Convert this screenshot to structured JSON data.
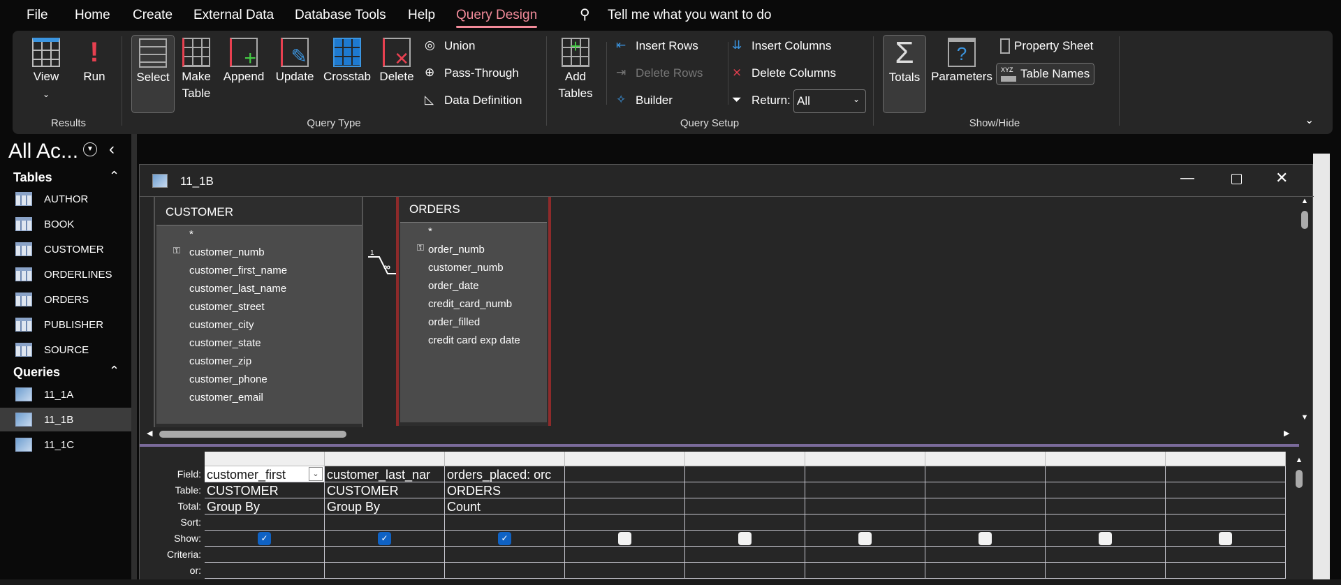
{
  "menu": {
    "items": [
      "File",
      "Home",
      "Create",
      "External Data",
      "Database Tools",
      "Help",
      "Query Design"
    ],
    "search": "Tell me what you want to do"
  },
  "ribbon": {
    "results": {
      "label": "Results",
      "view": "View",
      "run": "Run"
    },
    "query_type": {
      "label": "Query Type",
      "select": "Select",
      "make_table_1": "Make",
      "make_table_2": "Table",
      "append": "Append",
      "update": "Update",
      "crosstab": "Crosstab",
      "delete": "Delete",
      "union": "Union",
      "pass_through": "Pass-Through",
      "data_definition": "Data Definition"
    },
    "query_setup": {
      "label": "Query Setup",
      "add_tables_1": "Add",
      "add_tables_2": "Tables",
      "insert_rows": "Insert Rows",
      "delete_rows": "Delete Rows",
      "builder": "Builder",
      "insert_columns": "Insert Columns",
      "delete_columns": "Delete Columns",
      "return_label": "Return:",
      "return_value": "All"
    },
    "show_hide": {
      "label": "Show/Hide",
      "totals": "Totals",
      "parameters": "Parameters",
      "property_sheet": "Property Sheet",
      "table_names": "Table Names"
    }
  },
  "nav": {
    "title": "All Ac...",
    "tables_header": "Tables",
    "tables": [
      "AUTHOR",
      "BOOK",
      "CUSTOMER",
      "ORDERLINES",
      "ORDERS",
      "PUBLISHER",
      "SOURCE"
    ],
    "queries_header": "Queries",
    "queries": [
      "11_1A",
      "11_1B",
      "11_1C"
    ],
    "selected_query": "11_1B"
  },
  "document": {
    "title": "11_1B",
    "customer": {
      "name": "CUSTOMER",
      "fields": [
        "*",
        "customer_numb",
        "customer_first_name",
        "customer_last_name",
        "customer_street",
        "customer_city",
        "customer_state",
        "customer_zip",
        "customer_phone",
        "customer_email"
      ]
    },
    "orders": {
      "name": "ORDERS",
      "fields": [
        "*",
        "order_numb",
        "customer_numb",
        "order_date",
        "credit_card_numb",
        "order_filled",
        "credit card exp date"
      ]
    },
    "relationship": {
      "one": "1",
      "many": "∞"
    }
  },
  "grid": {
    "row_labels": [
      "Field:",
      "Table:",
      "Total:",
      "Sort:",
      "Show:",
      "Criteria:",
      "or:"
    ],
    "columns": [
      {
        "field": "customer_first",
        "table": "CUSTOMER",
        "total": "Group By",
        "show": true
      },
      {
        "field": "customer_last_nar",
        "table": "CUSTOMER",
        "total": "Group By",
        "show": true
      },
      {
        "field": "orders_placed: orc",
        "table": "ORDERS",
        "total": "Count",
        "show": true
      },
      {
        "field": "",
        "table": "",
        "total": "",
        "show": false
      },
      {
        "field": "",
        "table": "",
        "total": "",
        "show": false
      },
      {
        "field": "",
        "table": "",
        "total": "",
        "show": false
      },
      {
        "field": "",
        "table": "",
        "total": "",
        "show": false
      },
      {
        "field": "",
        "table": "",
        "total": "",
        "show": false
      },
      {
        "field": "",
        "table": "",
        "total": "",
        "show": false
      }
    ]
  }
}
